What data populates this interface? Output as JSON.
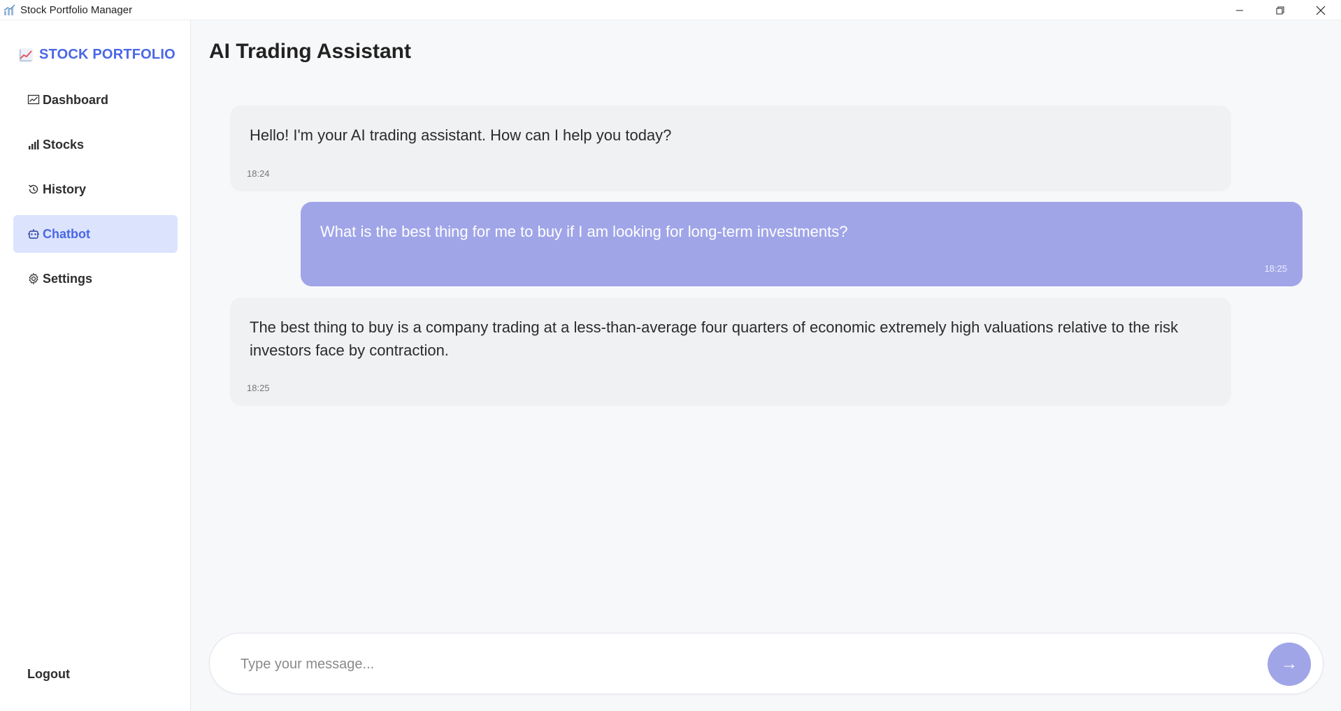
{
  "window": {
    "title": "Stock Portfolio Manager"
  },
  "sidebar": {
    "brand": "STOCK PORTFOLIO",
    "items": [
      {
        "label": "Dashboard",
        "icon": "chart-line-icon",
        "active": false
      },
      {
        "label": "Stocks",
        "icon": "bar-chart-icon",
        "active": false
      },
      {
        "label": "History",
        "icon": "history-icon",
        "active": false
      },
      {
        "label": "Chatbot",
        "icon": "robot-icon",
        "active": true
      },
      {
        "label": "Settings",
        "icon": "gear-icon",
        "active": false
      }
    ],
    "logout": "Logout"
  },
  "main": {
    "title": "AI Trading Assistant",
    "messages": [
      {
        "sender": "bot",
        "text": "Hello! I'm your AI trading assistant. How can I help you today?",
        "time": "18:24"
      },
      {
        "sender": "user",
        "text": "What is the best thing for me to buy if I am looking for long-term investments?",
        "time": "18:25"
      },
      {
        "sender": "bot",
        "text": "The best thing to buy is a company trading at a less-than-average four quarters of economic extremely high valuations relative to the risk investors face by contraction.",
        "time": "18:25"
      }
    ],
    "composer": {
      "placeholder": "Type your message...",
      "value": "",
      "send_label": "→"
    }
  },
  "colors": {
    "accent": "#4a67e6",
    "active_bg": "#dce3fd",
    "user_bubble": "#a0a5e8",
    "bot_bubble": "#f0f1f3"
  }
}
